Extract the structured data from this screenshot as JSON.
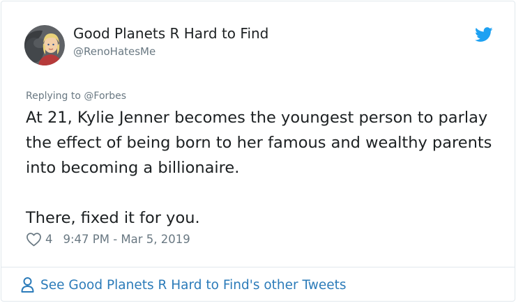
{
  "tweet": {
    "author_name": "Good Planets R Hard to Find",
    "handle": "@RenoHatesMe",
    "reply_prefix": "Replying to ",
    "reply_to": "@Forbes",
    "text_paragraph_1": "At 21, Kylie Jenner becomes the youngest person to parlay the effect of being born to her famous and wealthy parents into becoming a billionaire.",
    "text_paragraph_2": "There, fixed it for you.",
    "like_count": "4",
    "timestamp": "9:47 PM - Mar 5, 2019"
  },
  "footer": {
    "see_more_label": "See Good Planets R Hard to Find's other Tweets"
  },
  "icons": {
    "brand": "twitter-bird-icon",
    "like": "heart-icon",
    "profile": "person-icon"
  },
  "colors": {
    "brand_blue": "#1da1f2",
    "link_blue": "#2b7bb9",
    "text": "#1c2022",
    "muted": "#697882",
    "border": "#e1e8ed"
  }
}
